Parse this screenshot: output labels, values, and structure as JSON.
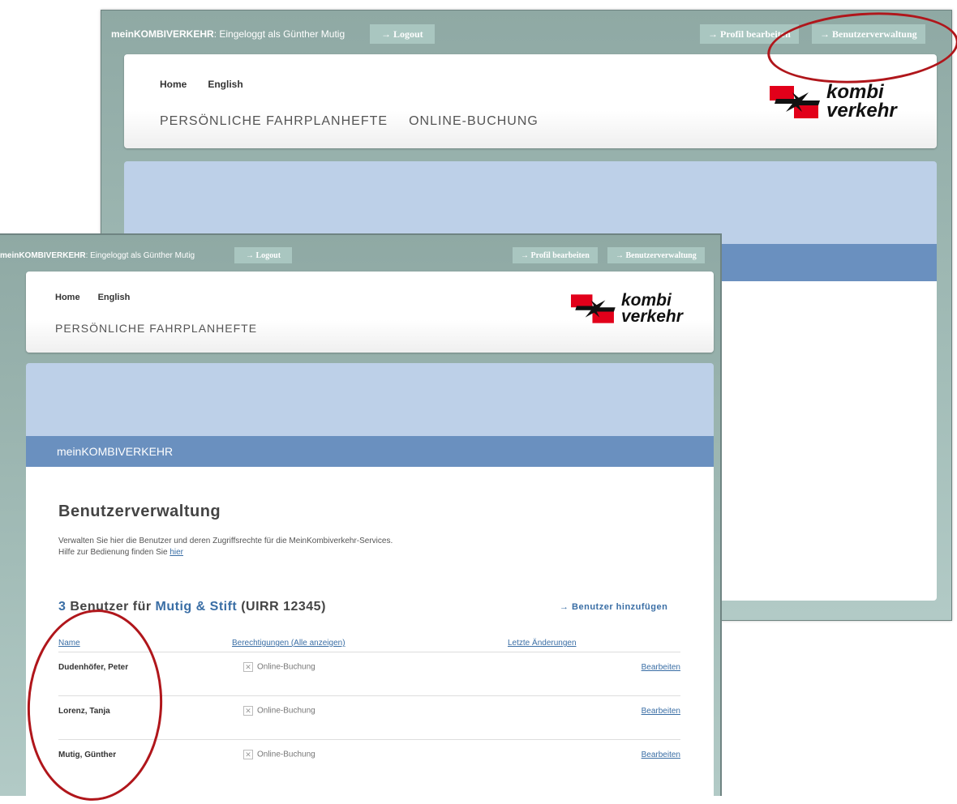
{
  "topbar": {
    "brand": "meinKOMBIVERKEHR",
    "login_text": ": Eingeloggt als Günther Mutig",
    "logout_label": "→ Logout",
    "profile_label": "→ Profil bearbeiten",
    "users_label": "→ Benutzerverwaltung"
  },
  "nav": {
    "home": "Home",
    "english": "English",
    "timetables": "PERSÖNLICHE FAHRPLANHEFTE",
    "booking": "ONLINE-BUCHUNG"
  },
  "logo": {
    "line1": "kombi",
    "line2": "verkehr"
  },
  "band_title": "meinKOMBIVERKEHR",
  "page": {
    "title": "Benutzerverwaltung",
    "intro": "Verwalten Sie hier die Benutzer und deren Zugriffsrechte für die MeinKombiverkehr-Services.",
    "help_prefix": "Hilfe zur Bedienung finden Sie",
    "help_link": "hier",
    "count": "3",
    "count_label": "Benutzer für",
    "company": "Mutig & Stift",
    "uirr": "(UIRR 12345)",
    "add_user": "→ Benutzer hinzufügen"
  },
  "table": {
    "col_name": "Name",
    "col_permissions": "Berechtigungen (Alle anzeigen)",
    "col_changes": "Letzte Änderungen",
    "rows": [
      {
        "name": "Dudenhöfer, Peter",
        "permission": "Online-Buchung",
        "action": "Bearbeiten"
      },
      {
        "name": "Lorenz, Tanja",
        "permission": "Online-Buchung",
        "action": "Bearbeiten"
      },
      {
        "name": "Mutig, Günther",
        "permission": "Online-Buchung",
        "action": "Bearbeiten"
      }
    ]
  },
  "colors": {
    "highlight": "#b0161b",
    "band": "#6a90bf",
    "link": "#3a6ea5"
  }
}
